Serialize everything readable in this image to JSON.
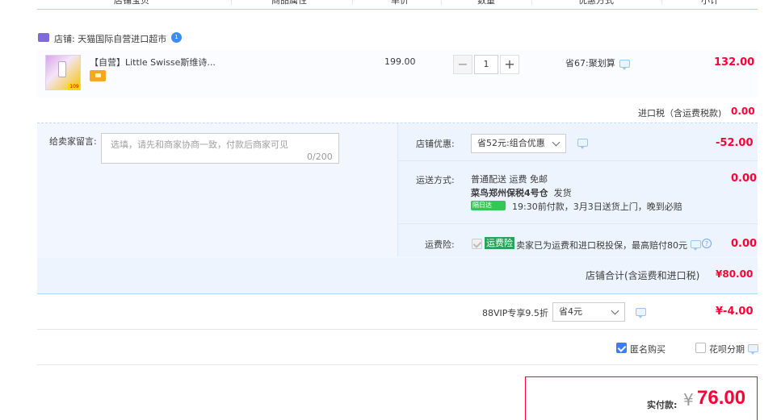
{
  "header": {
    "columns": [
      "店铺宝贝",
      "商品属性",
      "单价",
      "数量",
      "优惠方式",
      "小计"
    ]
  },
  "shop": {
    "label": "店铺: 天猫国际自营进口超市",
    "badge": "1"
  },
  "item": {
    "title": "【自营】Little Swisse斯维诗...",
    "thumb_tag": "109",
    "price": "199.00",
    "quantity": "1",
    "minus": "−",
    "plus": "+",
    "promo": "省67:聚划算",
    "subtotal": "132.00"
  },
  "tax": {
    "label": "进口税（含运费税款)",
    "value": "0.00"
  },
  "memo": {
    "label": "给卖家留言:",
    "placeholder": "选填，请先和商家协商一致，付款后商家可见",
    "count": "0/200"
  },
  "shop_discount": {
    "label": "店铺优惠:",
    "selected": "省52元:组合优惠",
    "value": "-52.00"
  },
  "shipping": {
    "label": "运送方式:",
    "line1": "普通配送 运费 免邮",
    "warehouse": "菜鸟郑州保税4号仓",
    "dispatch": "发货",
    "badge": "隔日达",
    "note": "19:30前付款，3月3日送货上门，晚到必赔",
    "value": "0.00"
  },
  "insurance": {
    "label": "运费险:",
    "tag": "运费险",
    "text": "卖家已为运费和进口税投保，最高赔付80元",
    "question": "?",
    "value": "0.00"
  },
  "shop_total": {
    "label": "店铺合计(含运费和进口税)",
    "value": "¥80.00"
  },
  "vip": {
    "label": "88VIP专享9.5折",
    "selected": "省4元",
    "value": "¥-4.00"
  },
  "options": {
    "anonymous": "匿名购买",
    "huabei": "花呗分期"
  },
  "payment": {
    "label": "实付款:",
    "symbol": "¥",
    "value": "76.00"
  },
  "colors": {
    "accent_red": "#ff0036",
    "panel_bg": "#f2f7ff",
    "checkbox_blue": "#3d7ef5"
  }
}
